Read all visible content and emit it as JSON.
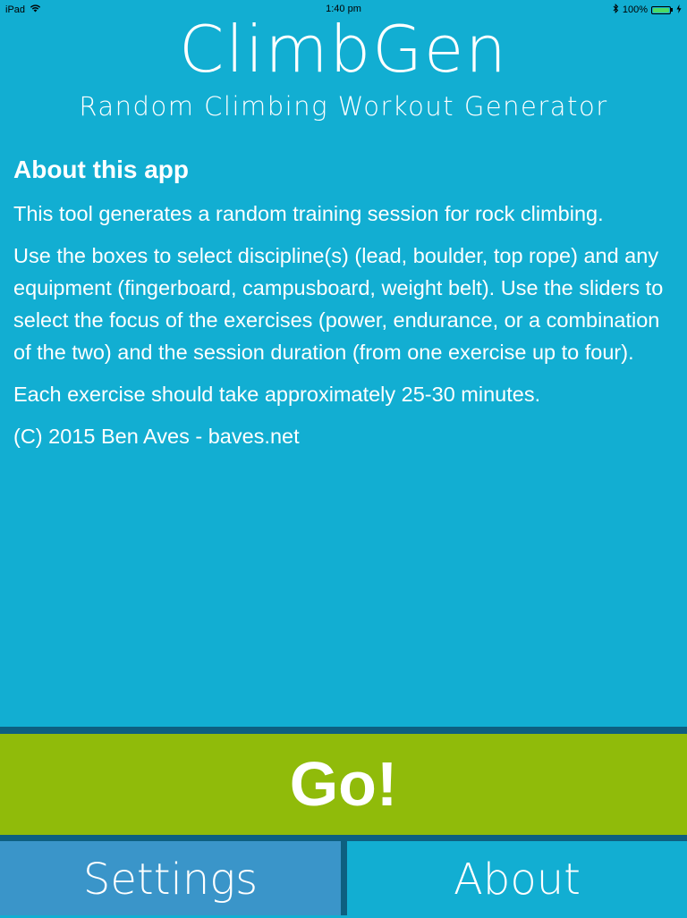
{
  "status_bar": {
    "device": "iPad",
    "time": "1:40 pm",
    "battery": "100%",
    "icons": [
      "wifi-icon",
      "bluetooth-icon",
      "battery-icon",
      "charging-icon"
    ]
  },
  "header": {
    "title": "ClimbGen",
    "subtitle": "Random Climbing Workout Generator"
  },
  "about": {
    "heading": "About this app",
    "paragraphs": [
      "This tool generates a random training session for rock climbing.",
      "Use the boxes to select discipline(s) (lead, boulder, top rope) and any equipment (fingerboard, campusboard, weight belt). Use the sliders to select the focus of the exercises (power, endurance, or a combination of the two) and the session duration (from one exercise up to four).",
      "Each exercise should take approximately 25-30 minutes.",
      "(C) 2015 Ben Aves - baves.net"
    ]
  },
  "actions": {
    "go_label": "Go!"
  },
  "tabs": {
    "settings_label": "Settings",
    "about_label": "About",
    "selected": "About"
  },
  "colors": {
    "background": "#12aed2",
    "go_button": "#90bb0a",
    "settings_tab": "#3a95c9",
    "divider": "#0d5f80",
    "text": "#ffffff"
  }
}
